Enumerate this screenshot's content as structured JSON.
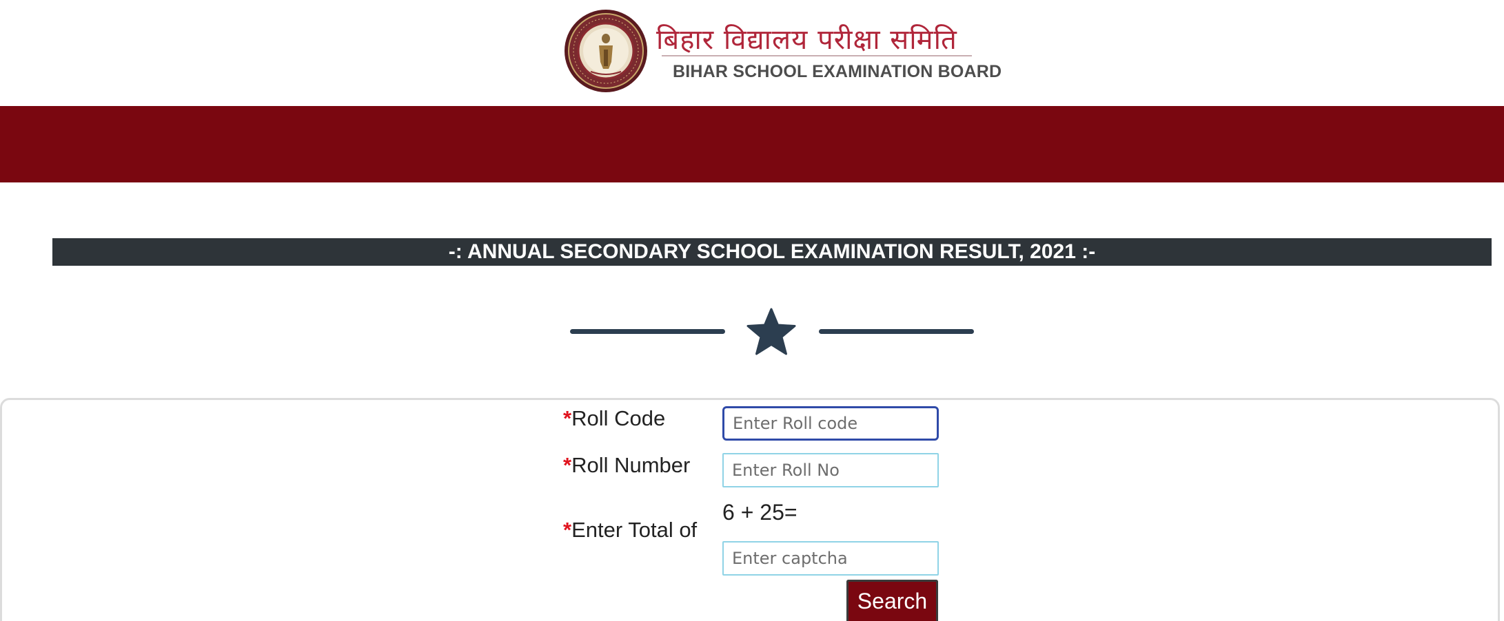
{
  "header": {
    "logo_hindi": "बिहार विद्यालय परीक्षा समिति",
    "logo_english": "BIHAR SCHOOL EXAMINATION BOARD"
  },
  "title_bar": {
    "text": "-: ANNUAL SECONDARY SCHOOL EXAMINATION RESULT, 2021 :-"
  },
  "form": {
    "required_marker": "*",
    "roll_code": {
      "label": "Roll Code",
      "placeholder": "Enter Roll code",
      "value": ""
    },
    "roll_number": {
      "label": "Roll Number",
      "placeholder": "Enter Roll No",
      "value": ""
    },
    "captcha": {
      "label": "Enter Total of",
      "question": "6 + 25=",
      "placeholder": "Enter captcha",
      "value": ""
    },
    "search_label": "Search"
  },
  "colors": {
    "brand_maroon": "#7a0710",
    "title_bar_bg": "#2e3439",
    "divider": "#2c3e50",
    "required": "#e0141e",
    "input_border": "#8fd3e6",
    "input_focus_border": "#2f4aa8"
  },
  "icons": {
    "divider_icon": "star-icon",
    "logo": "bseb-seal-logo"
  }
}
